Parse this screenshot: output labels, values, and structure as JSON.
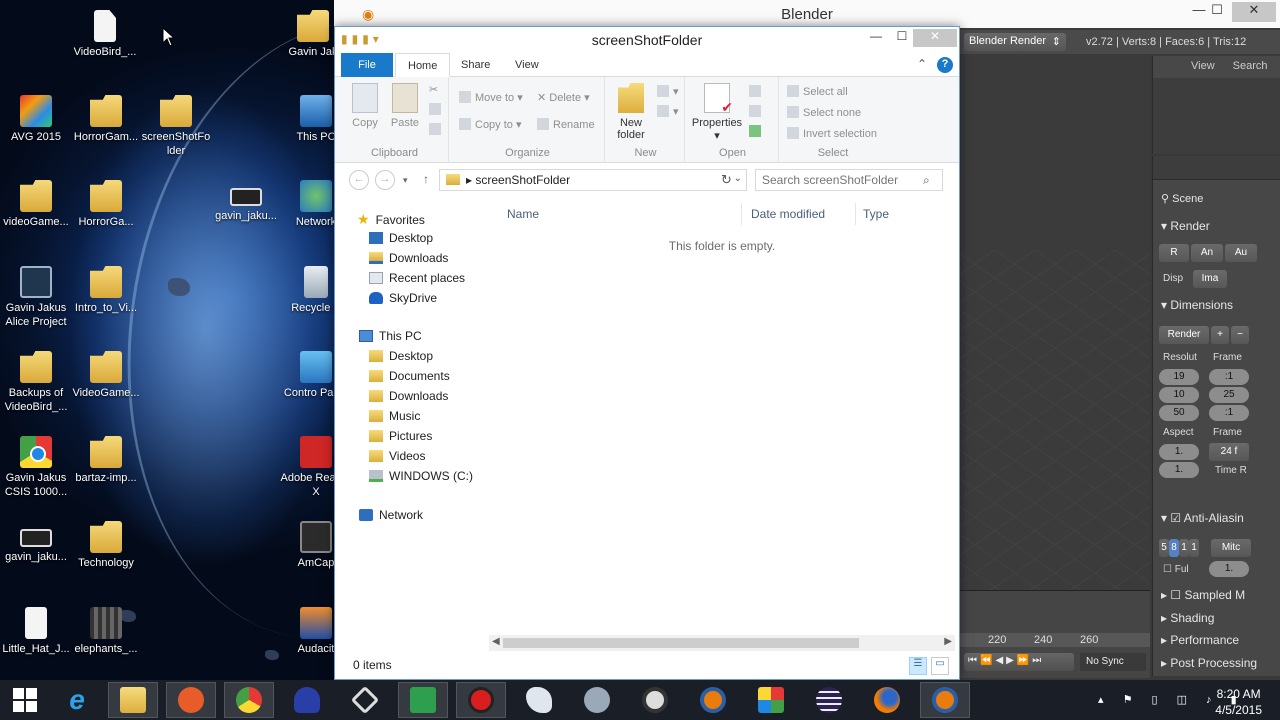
{
  "desktop": {
    "icons": [
      {
        "label": "VideoBird_...",
        "icon": "file-icon"
      },
      {
        "label": "Gavin Jak",
        "icon": "folder-icon"
      },
      {
        "label": "AVG 2015",
        "icon": "avg-icon"
      },
      {
        "label": "HorrorGam...",
        "icon": "folder-icon"
      },
      {
        "label": "screenShotFo lder",
        "icon": "folder-icon"
      },
      {
        "label": "This PC",
        "icon": "computer-icon"
      },
      {
        "label": "videoGame...",
        "icon": "folder-icon"
      },
      {
        "label": "HorrorGa...",
        "icon": "folder-icon"
      },
      {
        "label": "gavin_jaku...",
        "icon": "video-icon"
      },
      {
        "label": "Network",
        "icon": "network-icon"
      },
      {
        "label": "Gavin Jakus Alice Project",
        "icon": "app-icon"
      },
      {
        "label": "Intro_to_Vi...",
        "icon": "folder-icon"
      },
      {
        "label": "Recycle B",
        "icon": "recycle-bin-icon"
      },
      {
        "label": "Backups of VideoBird_...",
        "icon": "folder-icon"
      },
      {
        "label": "VideoGame...",
        "icon": "folder-icon"
      },
      {
        "label": "Contro Panel",
        "icon": "control-panel-icon"
      },
      {
        "label": "Gavin Jakus CSIS 1000...",
        "icon": "chrome-icon"
      },
      {
        "label": "bartaz-imp...",
        "icon": "folder-icon"
      },
      {
        "label": "Adobe Reader X",
        "icon": "pdf-icon"
      },
      {
        "label": "gavin_jaku...",
        "icon": "video-icon"
      },
      {
        "label": "Technology",
        "icon": "folder-icon"
      },
      {
        "label": "AmCap",
        "icon": "amcap-icon"
      },
      {
        "label": "Little_Hat_J...",
        "icon": "mp3-icon"
      },
      {
        "label": "elephants_...",
        "icon": "film-icon"
      },
      {
        "label": "Audacit",
        "icon": "audacity-icon"
      }
    ]
  },
  "blender": {
    "title": "Blender",
    "render_engine": "Blender Render",
    "stats": "v2.72 | Verts:8 | Faces:6 | Tris:12",
    "outliner": {
      "view": "View",
      "search": "Search"
    },
    "props": {
      "scene": "Scene",
      "render": "Render",
      "render_btns": [
        "R",
        "An",
        "Au"
      ],
      "disp": "Disp",
      "disp_val": "Ima",
      "dimensions": "Dimensions",
      "preset": "Render",
      "resolution": "Resolut",
      "frame": "Frame",
      "res_vals": [
        "19",
        "10",
        "50"
      ],
      "frame_vals": [
        ":1",
        "25",
        ":1"
      ],
      "aspect": "Aspect",
      "frame2": "Frame",
      "aspect_vals": [
        "1.",
        "1."
      ],
      "fps": "24 f",
      "time_r": "Time R",
      "anti_alias": "Anti-Aliasin",
      "aa_samples": [
        "5",
        "8",
        "1",
        "1"
      ],
      "filter": "Mitc",
      "full": "Ful",
      "full_val": "1.",
      "sampled": "Sampled M",
      "shading": "Shading",
      "performance": "Performance",
      "post": "Post Processing"
    },
    "timeline": {
      "ticks": [
        "220",
        "240",
        "260"
      ],
      "sync": "No Sync"
    }
  },
  "explorer": {
    "title": "screenShotFolder",
    "tabs": {
      "file": "File",
      "home": "Home",
      "share": "Share",
      "view": "View"
    },
    "ribbon": {
      "clipboard": {
        "label": "Clipboard",
        "copy": "Copy",
        "paste": "Paste"
      },
      "organize": {
        "label": "Organize",
        "move_to": "Move to",
        "copy_to": "Copy to",
        "delete": "Delete",
        "rename": "Rename"
      },
      "new": {
        "label": "New",
        "new_folder": "New folder"
      },
      "open": {
        "label": "Open",
        "properties": "Properties"
      },
      "select": {
        "label": "Select",
        "select_all": "Select all",
        "select_none": "Select none",
        "invert": "Invert selection"
      }
    },
    "address": "screenShotFolder",
    "search_placeholder": "Search screenShotFolder",
    "nav": {
      "favorites": "Favorites",
      "fav_items": [
        "Desktop",
        "Downloads",
        "Recent places",
        "SkyDrive"
      ],
      "this_pc": "This PC",
      "pc_items": [
        "Desktop",
        "Documents",
        "Downloads",
        "Music",
        "Pictures",
        "Videos",
        "WINDOWS (C:)"
      ],
      "network": "Network"
    },
    "columns": {
      "name": "Name",
      "date": "Date modified",
      "type": "Type"
    },
    "empty_text": "This folder is empty.",
    "status": "0 items"
  },
  "taskbar": {
    "apps": [
      "start-icon",
      "internet-explorer-icon",
      "file-explorer-icon",
      "power-icon",
      "chrome-icon",
      "headphones-icon",
      "unity-icon",
      "download-icon",
      "record-icon",
      "bird-icon",
      "network-drive-icon",
      "obs-icon",
      "blender-icon",
      "office-icon",
      "eclipse-icon",
      "firefox-icon",
      "blender-icon"
    ],
    "clock": {
      "time": "8:20 AM",
      "date": "4/5/2015"
    }
  }
}
